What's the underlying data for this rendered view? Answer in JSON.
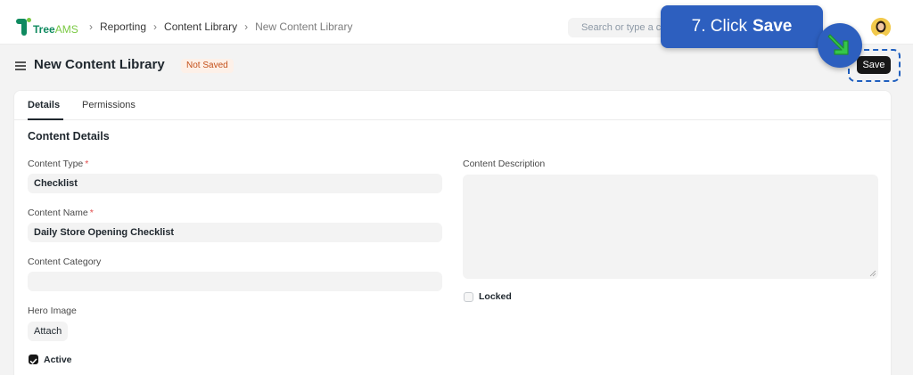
{
  "brand": {
    "name_main": "Tree",
    "name_suffix": "AMS"
  },
  "breadcrumb": {
    "items": [
      "Reporting",
      "Content Library"
    ],
    "current": "New Content Library"
  },
  "search": {
    "placeholder": "Search or type a c"
  },
  "page": {
    "title": "New Content Library",
    "status": "Not Saved",
    "save_label": "Save"
  },
  "tooltip": {
    "prefix": "7. Click",
    "emphasis": "Save"
  },
  "tabs": [
    {
      "label": "Details",
      "active": true
    },
    {
      "label": "Permissions",
      "active": false
    }
  ],
  "section": {
    "title": "Content Details"
  },
  "form": {
    "content_type": {
      "label": "Content Type",
      "required_mark": "*",
      "value": "Checklist"
    },
    "content_name": {
      "label": "Content Name",
      "required_mark": "*",
      "value": "Daily Store Opening Checklist"
    },
    "content_category": {
      "label": "Content Category",
      "value": ""
    },
    "hero_image": {
      "label": "Hero Image",
      "button": "Attach"
    },
    "active": {
      "label": "Active",
      "checked": true
    },
    "content_description": {
      "label": "Content Description",
      "value": ""
    },
    "locked": {
      "label": "Locked",
      "checked": false
    }
  },
  "colors": {
    "accent": "#2d5fbf",
    "brand_green": "#0f8a5f",
    "status_orange": "#c4501a",
    "primary_button": "#171717"
  }
}
